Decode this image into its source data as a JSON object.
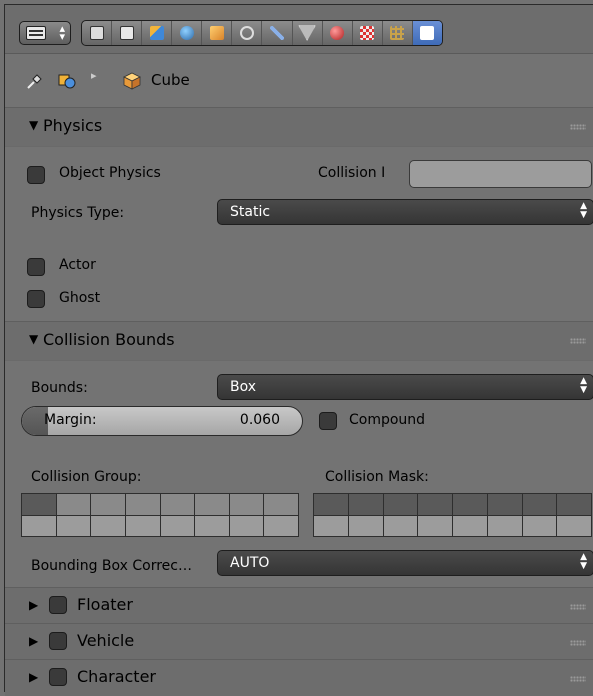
{
  "header": {
    "tab_icons": [
      "render-icon",
      "render-layers-icon",
      "scene-icon",
      "world-icon",
      "object-icon",
      "constraints-icon",
      "modifiers-icon",
      "data-icon",
      "material-icon",
      "texture-icon",
      "particles-icon",
      "physics-icon"
    ]
  },
  "breadcrumb": {
    "object_name": "Cube"
  },
  "physics": {
    "title": "Physics",
    "object_physics_label": "Object Physics",
    "collision_label": "Collision I",
    "collision_value": "",
    "physics_type_label": "Physics Type:",
    "physics_type_value": "Static",
    "actor_label": "Actor",
    "ghost_label": "Ghost"
  },
  "collision_bounds": {
    "title": "Collision Bounds",
    "bounds_label": "Bounds:",
    "bounds_value": "Box",
    "margin_label": "Margin:",
    "margin_value": "0.060",
    "compound_label": "Compound",
    "collision_group_label": "Collision Group:",
    "collision_mask_label": "Collision Mask:",
    "bbox_correction_label": "Bounding Box Correc…",
    "bbox_correction_value": "AUTO"
  },
  "subpanels": [
    {
      "label": "Floater"
    },
    {
      "label": "Vehicle"
    },
    {
      "label": "Character"
    }
  ],
  "colors": {
    "panel_bg": "#737373",
    "dropdown_bg": "#3d3d3d",
    "active_tab": "#4a78c8"
  }
}
